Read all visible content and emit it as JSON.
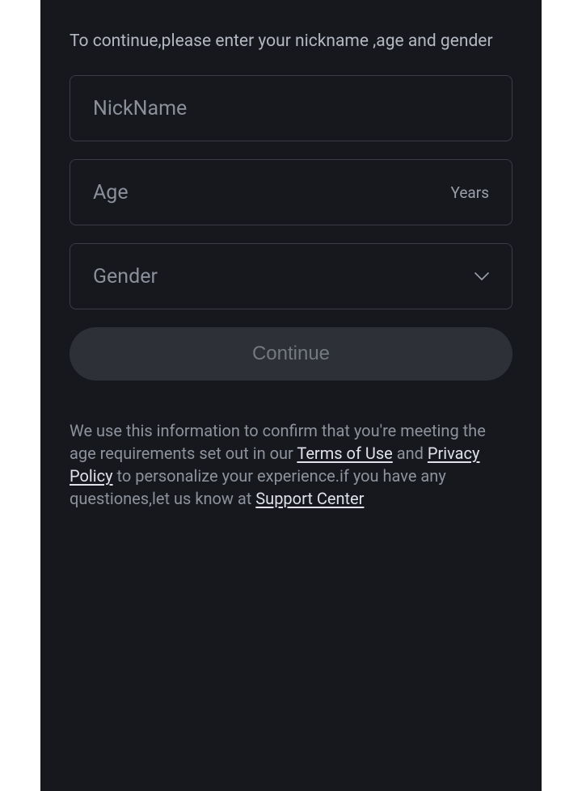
{
  "instruction": "To continue,please enter your nickname ,age and gender",
  "fields": {
    "nickname": {
      "placeholder": "NickName"
    },
    "age": {
      "placeholder": "Age",
      "suffix": "Years"
    },
    "gender": {
      "placeholder": "Gender"
    }
  },
  "continue_label": "Continue",
  "disclaimer": {
    "part1": "We use this information to confirm that you're meeting the age requirements set out in our ",
    "terms_link": "Terms of Use",
    "part2": " and ",
    "privacy_link": "Privacy Policy",
    "part3": " to personalize your experience.if you have any questiones,let us know at ",
    "support_link": "Support Center"
  }
}
